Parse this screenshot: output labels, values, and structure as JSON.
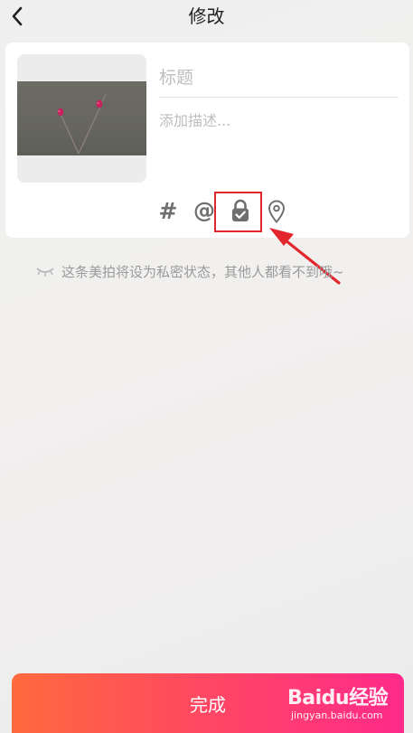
{
  "header": {
    "title": "修改"
  },
  "post_editor": {
    "title_placeholder": "标题",
    "description_placeholder": "添加描述...",
    "toolbar": {
      "hashtag_label": "#",
      "mention_label": "@",
      "icons": [
        "hashtag-icon",
        "mention-icon",
        "lock-icon",
        "location-pin-icon"
      ]
    }
  },
  "privacy_notice": {
    "text": "这条美拍将设为私密状态，其他人都看不到哦~",
    "icon": "closed-eye-icon"
  },
  "done_button": {
    "label": "完成"
  },
  "annotation": {
    "highlight_color": "#e2262c"
  },
  "watermark": {
    "brand": "Baidu经验",
    "url": "jingyan.baidu.com"
  },
  "colors": {
    "button_gradient_start": "#ff6a3d",
    "button_gradient_end": "#ff2a8a"
  }
}
